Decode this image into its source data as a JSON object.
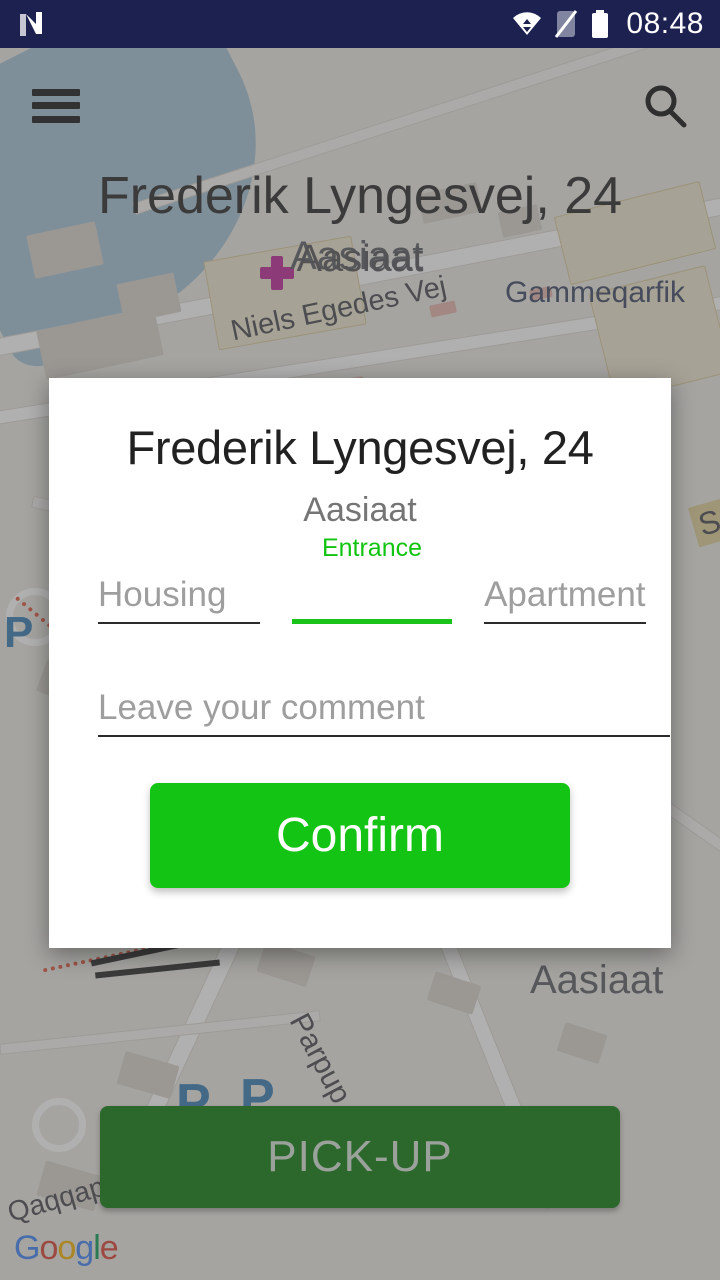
{
  "status_bar": {
    "time": "08:48",
    "icons": [
      "n-logo-icon",
      "wifi-icon",
      "no-sim-icon",
      "battery-icon"
    ]
  },
  "app_bar": {
    "menu_icon": "hamburger-menu-icon",
    "search_icon": "search-icon"
  },
  "map": {
    "title": "Frederik Lyngesvej, 24",
    "subtitle": "Aasiaat",
    "labels": [
      {
        "text": "Aasiaat",
        "kind": "place"
      },
      {
        "text": "Gammeqarfik",
        "kind": "street"
      },
      {
        "text": "Niels Egedes Vej",
        "kind": "street"
      },
      {
        "text": "Parpup aqquta",
        "kind": "street"
      },
      {
        "text": "Aasiaat",
        "kind": "place"
      },
      {
        "text": "Qaqqap T",
        "kind": "street"
      },
      {
        "text": "Su",
        "kind": "street"
      }
    ],
    "parking_marker": "P",
    "attribution": "Google",
    "attribution_letters": [
      "G",
      "o",
      "o",
      "g",
      "l",
      "e"
    ]
  },
  "pickup_button": {
    "label": "PICK-UP",
    "color": "#0f7a0f",
    "text_color": "#d9e6d9"
  },
  "dialog": {
    "title": "Frederik Lyngesvej, 24",
    "subtitle": "Aasiaat",
    "fields": [
      {
        "name": "housing",
        "label": "",
        "value": "",
        "placeholder": "Housing",
        "focused": false
      },
      {
        "name": "entrance",
        "label": "Entrance",
        "value": "",
        "placeholder": "",
        "focused": true
      },
      {
        "name": "apartment",
        "label": "",
        "value": "",
        "placeholder": "Apartment",
        "focused": false
      },
      {
        "name": "comment",
        "label": "",
        "value": "",
        "placeholder": "Leave your comment",
        "focused": false
      }
    ],
    "confirm_button": {
      "label": "Confirm",
      "color": "#14c414",
      "text_color": "#ffffff"
    },
    "accent_color": "#19c319"
  }
}
